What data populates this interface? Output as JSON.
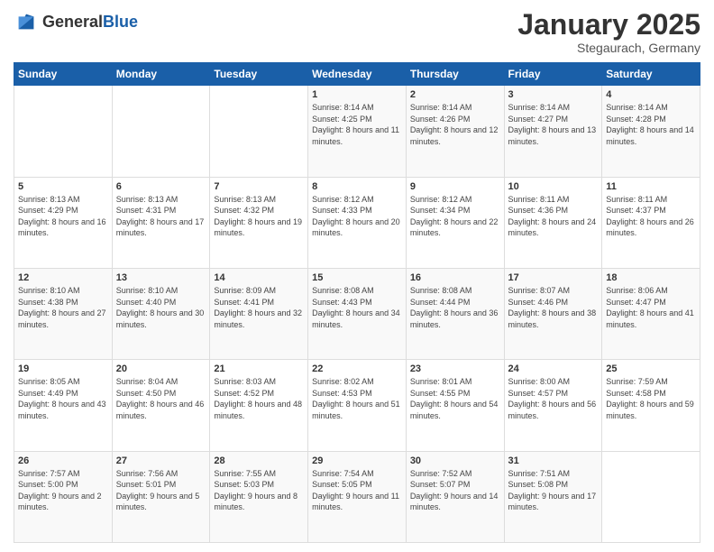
{
  "header": {
    "logo": {
      "general": "General",
      "blue": "Blue"
    },
    "title": "January 2025",
    "location": "Stegaurach, Germany"
  },
  "days_of_week": [
    "Sunday",
    "Monday",
    "Tuesday",
    "Wednesday",
    "Thursday",
    "Friday",
    "Saturday"
  ],
  "weeks": [
    [
      {
        "day": "",
        "sunrise": "",
        "sunset": "",
        "daylight": ""
      },
      {
        "day": "",
        "sunrise": "",
        "sunset": "",
        "daylight": ""
      },
      {
        "day": "",
        "sunrise": "",
        "sunset": "",
        "daylight": ""
      },
      {
        "day": "1",
        "sunrise": "Sunrise: 8:14 AM",
        "sunset": "Sunset: 4:25 PM",
        "daylight": "Daylight: 8 hours and 11 minutes."
      },
      {
        "day": "2",
        "sunrise": "Sunrise: 8:14 AM",
        "sunset": "Sunset: 4:26 PM",
        "daylight": "Daylight: 8 hours and 12 minutes."
      },
      {
        "day": "3",
        "sunrise": "Sunrise: 8:14 AM",
        "sunset": "Sunset: 4:27 PM",
        "daylight": "Daylight: 8 hours and 13 minutes."
      },
      {
        "day": "4",
        "sunrise": "Sunrise: 8:14 AM",
        "sunset": "Sunset: 4:28 PM",
        "daylight": "Daylight: 8 hours and 14 minutes."
      }
    ],
    [
      {
        "day": "5",
        "sunrise": "Sunrise: 8:13 AM",
        "sunset": "Sunset: 4:29 PM",
        "daylight": "Daylight: 8 hours and 16 minutes."
      },
      {
        "day": "6",
        "sunrise": "Sunrise: 8:13 AM",
        "sunset": "Sunset: 4:31 PM",
        "daylight": "Daylight: 8 hours and 17 minutes."
      },
      {
        "day": "7",
        "sunrise": "Sunrise: 8:13 AM",
        "sunset": "Sunset: 4:32 PM",
        "daylight": "Daylight: 8 hours and 19 minutes."
      },
      {
        "day": "8",
        "sunrise": "Sunrise: 8:12 AM",
        "sunset": "Sunset: 4:33 PM",
        "daylight": "Daylight: 8 hours and 20 minutes."
      },
      {
        "day": "9",
        "sunrise": "Sunrise: 8:12 AM",
        "sunset": "Sunset: 4:34 PM",
        "daylight": "Daylight: 8 hours and 22 minutes."
      },
      {
        "day": "10",
        "sunrise": "Sunrise: 8:11 AM",
        "sunset": "Sunset: 4:36 PM",
        "daylight": "Daylight: 8 hours and 24 minutes."
      },
      {
        "day": "11",
        "sunrise": "Sunrise: 8:11 AM",
        "sunset": "Sunset: 4:37 PM",
        "daylight": "Daylight: 8 hours and 26 minutes."
      }
    ],
    [
      {
        "day": "12",
        "sunrise": "Sunrise: 8:10 AM",
        "sunset": "Sunset: 4:38 PM",
        "daylight": "Daylight: 8 hours and 27 minutes."
      },
      {
        "day": "13",
        "sunrise": "Sunrise: 8:10 AM",
        "sunset": "Sunset: 4:40 PM",
        "daylight": "Daylight: 8 hours and 30 minutes."
      },
      {
        "day": "14",
        "sunrise": "Sunrise: 8:09 AM",
        "sunset": "Sunset: 4:41 PM",
        "daylight": "Daylight: 8 hours and 32 minutes."
      },
      {
        "day": "15",
        "sunrise": "Sunrise: 8:08 AM",
        "sunset": "Sunset: 4:43 PM",
        "daylight": "Daylight: 8 hours and 34 minutes."
      },
      {
        "day": "16",
        "sunrise": "Sunrise: 8:08 AM",
        "sunset": "Sunset: 4:44 PM",
        "daylight": "Daylight: 8 hours and 36 minutes."
      },
      {
        "day": "17",
        "sunrise": "Sunrise: 8:07 AM",
        "sunset": "Sunset: 4:46 PM",
        "daylight": "Daylight: 8 hours and 38 minutes."
      },
      {
        "day": "18",
        "sunrise": "Sunrise: 8:06 AM",
        "sunset": "Sunset: 4:47 PM",
        "daylight": "Daylight: 8 hours and 41 minutes."
      }
    ],
    [
      {
        "day": "19",
        "sunrise": "Sunrise: 8:05 AM",
        "sunset": "Sunset: 4:49 PM",
        "daylight": "Daylight: 8 hours and 43 minutes."
      },
      {
        "day": "20",
        "sunrise": "Sunrise: 8:04 AM",
        "sunset": "Sunset: 4:50 PM",
        "daylight": "Daylight: 8 hours and 46 minutes."
      },
      {
        "day": "21",
        "sunrise": "Sunrise: 8:03 AM",
        "sunset": "Sunset: 4:52 PM",
        "daylight": "Daylight: 8 hours and 48 minutes."
      },
      {
        "day": "22",
        "sunrise": "Sunrise: 8:02 AM",
        "sunset": "Sunset: 4:53 PM",
        "daylight": "Daylight: 8 hours and 51 minutes."
      },
      {
        "day": "23",
        "sunrise": "Sunrise: 8:01 AM",
        "sunset": "Sunset: 4:55 PM",
        "daylight": "Daylight: 8 hours and 54 minutes."
      },
      {
        "day": "24",
        "sunrise": "Sunrise: 8:00 AM",
        "sunset": "Sunset: 4:57 PM",
        "daylight": "Daylight: 8 hours and 56 minutes."
      },
      {
        "day": "25",
        "sunrise": "Sunrise: 7:59 AM",
        "sunset": "Sunset: 4:58 PM",
        "daylight": "Daylight: 8 hours and 59 minutes."
      }
    ],
    [
      {
        "day": "26",
        "sunrise": "Sunrise: 7:57 AM",
        "sunset": "Sunset: 5:00 PM",
        "daylight": "Daylight: 9 hours and 2 minutes."
      },
      {
        "day": "27",
        "sunrise": "Sunrise: 7:56 AM",
        "sunset": "Sunset: 5:01 PM",
        "daylight": "Daylight: 9 hours and 5 minutes."
      },
      {
        "day": "28",
        "sunrise": "Sunrise: 7:55 AM",
        "sunset": "Sunset: 5:03 PM",
        "daylight": "Daylight: 9 hours and 8 minutes."
      },
      {
        "day": "29",
        "sunrise": "Sunrise: 7:54 AM",
        "sunset": "Sunset: 5:05 PM",
        "daylight": "Daylight: 9 hours and 11 minutes."
      },
      {
        "day": "30",
        "sunrise": "Sunrise: 7:52 AM",
        "sunset": "Sunset: 5:07 PM",
        "daylight": "Daylight: 9 hours and 14 minutes."
      },
      {
        "day": "31",
        "sunrise": "Sunrise: 7:51 AM",
        "sunset": "Sunset: 5:08 PM",
        "daylight": "Daylight: 9 hours and 17 minutes."
      },
      {
        "day": "",
        "sunrise": "",
        "sunset": "",
        "daylight": ""
      }
    ]
  ]
}
